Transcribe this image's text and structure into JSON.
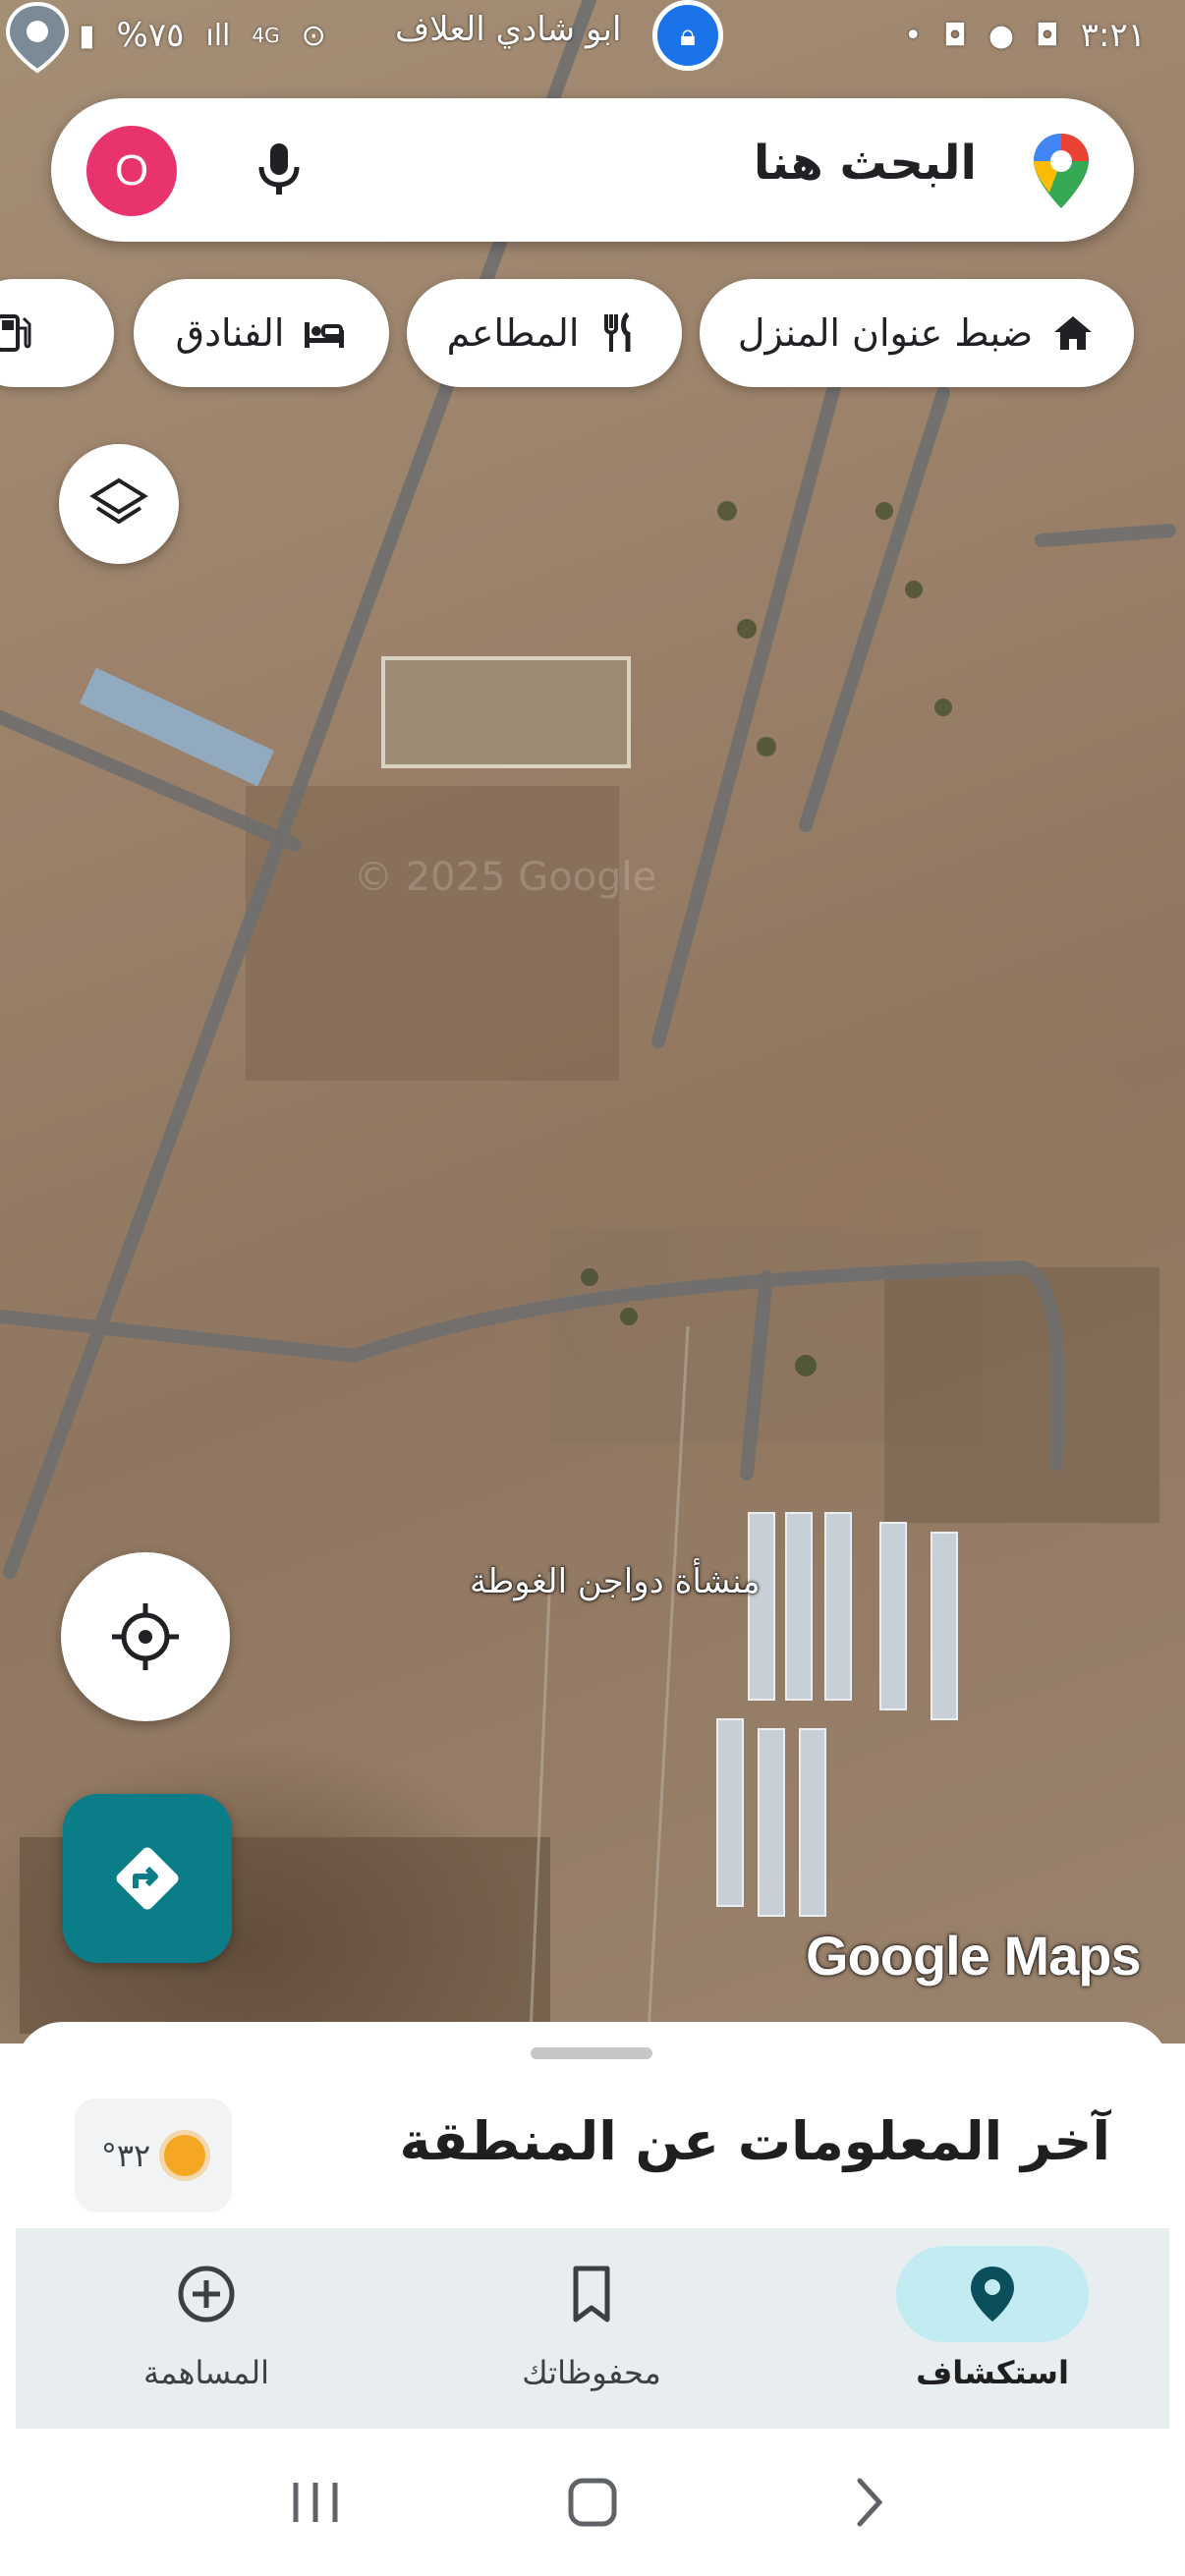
{
  "status_bar": {
    "time": "٣:٢١",
    "battery": "%٧٥",
    "network": "4G",
    "location_title": "ابو شادي العلاف"
  },
  "map": {
    "watermark": "© 2025 Google",
    "place_label": "منشأة دواجن الغوطة",
    "logo": "Google Maps"
  },
  "search": {
    "placeholder": "البحث هنا",
    "avatar_letter": "O",
    "avatar_color": "#e8336c"
  },
  "chips": [
    {
      "label": "ضبط عنوان المنزل",
      "icon": "home-icon"
    },
    {
      "label": "المطاعم",
      "icon": "restaurant-icon"
    },
    {
      "label": "الفنادق",
      "icon": "hotel-icon"
    },
    {
      "label": "",
      "icon": "gas-station-icon"
    }
  ],
  "sheet": {
    "title": "آخر المعلومات عن المنطقة",
    "temperature": "٣٢°"
  },
  "nav": [
    {
      "label": "استكشاف",
      "icon": "explore-pin-icon",
      "active": true
    },
    {
      "label": "محفوظاتك",
      "icon": "bookmark-icon",
      "active": false
    },
    {
      "label": "المساهمة",
      "icon": "add-circle-icon",
      "active": false
    }
  ],
  "colors": {
    "accent_teal": "#0a7d88",
    "active_nav_bg": "#c2ecf2",
    "pin_blue": "#1a73e8"
  }
}
